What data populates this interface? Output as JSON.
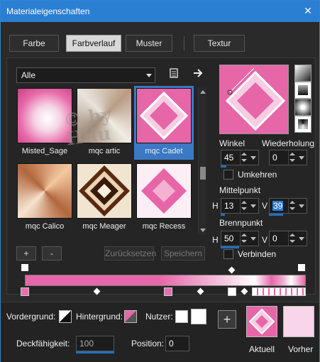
{
  "window": {
    "title": "Materialeigenschaften",
    "close": "✕"
  },
  "tabs": [
    {
      "label": "Farbe"
    },
    {
      "label": "Farbverlauf",
      "active": true
    },
    {
      "label": "Muster"
    },
    {
      "label": "Textur"
    }
  ],
  "library": {
    "category": "Alle",
    "watermark": "© by Hilu",
    "items": [
      {
        "label": "Misted_Sage"
      },
      {
        "label": "mqc artic"
      },
      {
        "label": "mqc Cadet",
        "selected": true
      },
      {
        "label": "mqc Calico"
      },
      {
        "label": "mqc Meager"
      },
      {
        "label": "mqc Recess"
      }
    ]
  },
  "buttons": {
    "add": "+",
    "remove": "-",
    "reset": "Zurücksetzen",
    "save": "Speichern"
  },
  "settings": {
    "angle_label": "Winkel",
    "angle": "45",
    "repeat_label": "Wiederholung",
    "repeat": "0",
    "invert_label": "Umkehren",
    "center_label": "Mittelpunkt",
    "center_h_label": "H",
    "center_h": "13",
    "center_v_label": "V",
    "center_v": "39",
    "focus_label": "Brennpunkt",
    "focus_h_label": "H",
    "focus_h": "50",
    "focus_v_label": "V",
    "focus_v": "0",
    "link_label": "Verbinden"
  },
  "bottom": {
    "foreground_label": "Vordergrund:",
    "background_label": "Hintergrund:",
    "user_label": "Nutzer:",
    "opacity_label": "Deckfähigkeit:",
    "opacity": "100",
    "position_label": "Position:",
    "position": "0",
    "current_label": "Aktuell",
    "previous_label": "Vorher"
  },
  "colors": {
    "accent": "#2b7fd3",
    "pink": "#e66aa9"
  }
}
